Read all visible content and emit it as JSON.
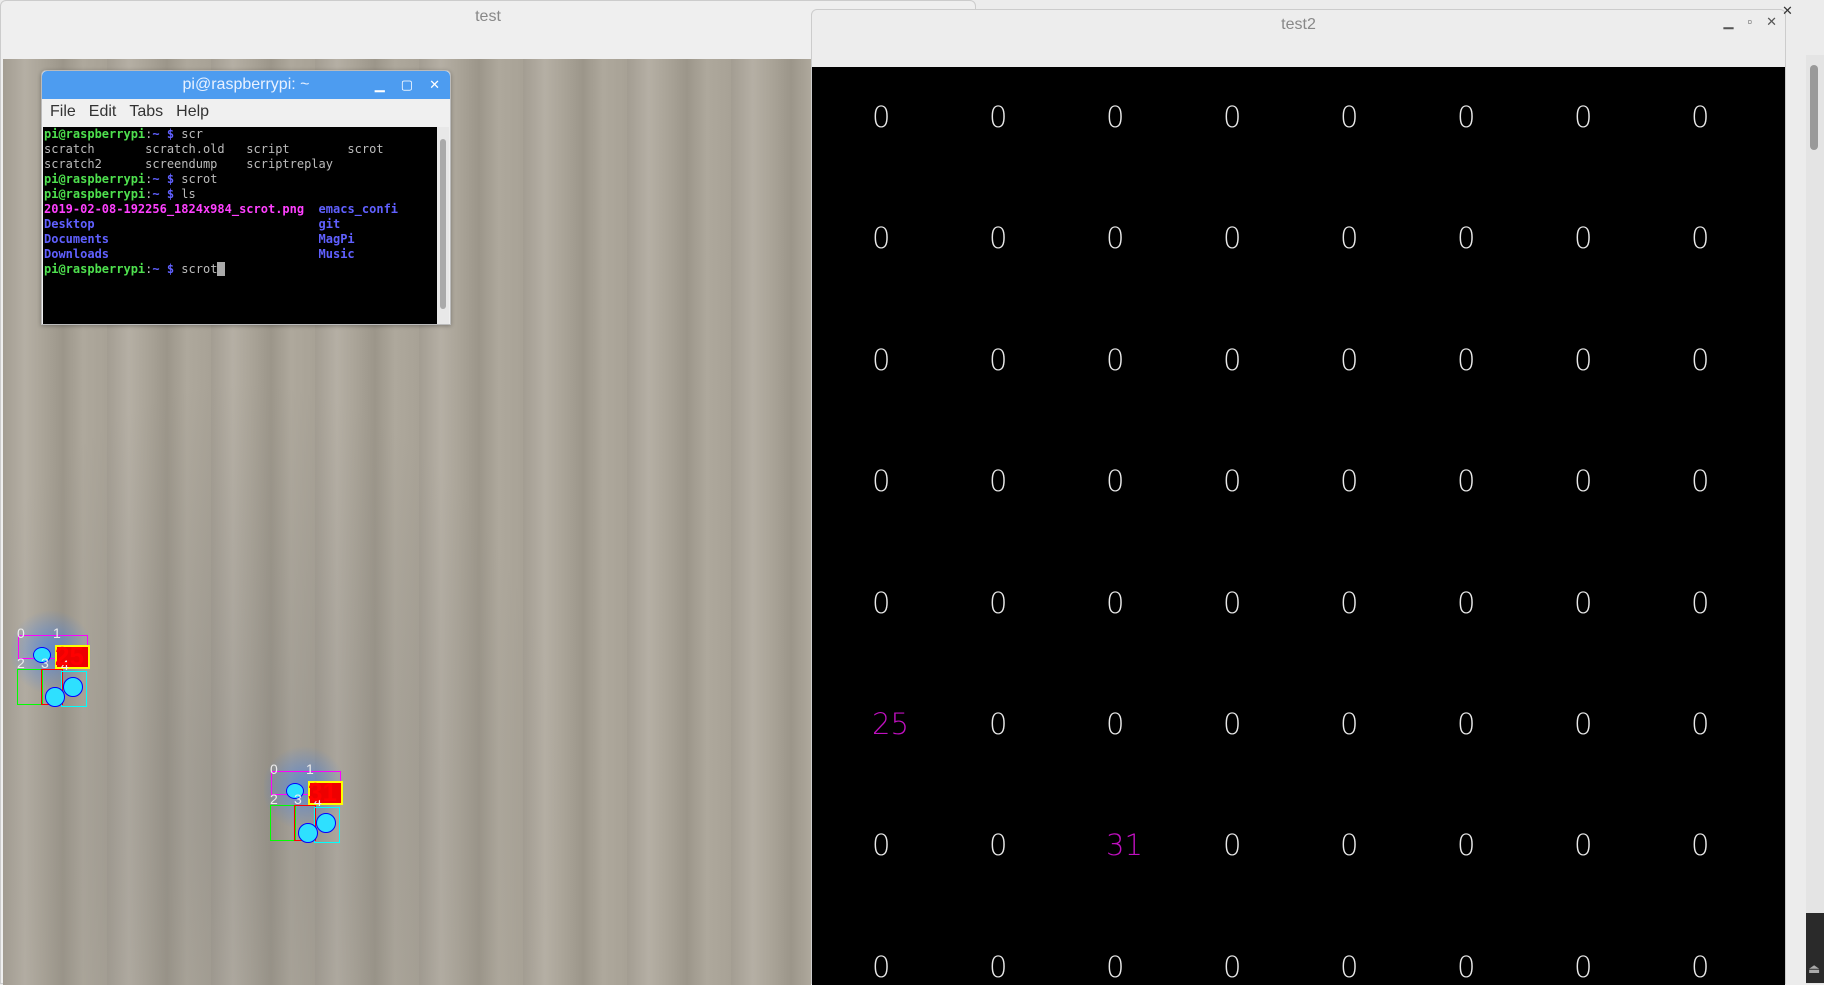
{
  "window1": {
    "title": "test"
  },
  "window2": {
    "title": "test2"
  },
  "terminal": {
    "title": "pi@raspberrypi: ~",
    "menu": [
      "File",
      "Edit",
      "Tabs",
      "Help"
    ],
    "lines": [
      [
        {
          "c": "g",
          "t": "pi@raspberrypi"
        },
        {
          "c": "w",
          "t": ":"
        },
        {
          "c": "b",
          "t": "~ $"
        },
        {
          "c": "w",
          "t": " scr"
        }
      ],
      [
        {
          "c": "w",
          "t": "scratch       scratch.old   script        scrot"
        }
      ],
      [
        {
          "c": "w",
          "t": "scratch2      screendump    scriptreplay"
        }
      ],
      [
        {
          "c": "g",
          "t": "pi@raspberrypi"
        },
        {
          "c": "w",
          "t": ":"
        },
        {
          "c": "b",
          "t": "~ $"
        },
        {
          "c": "w",
          "t": " scrot"
        }
      ],
      [
        {
          "c": "g",
          "t": "pi@raspberrypi"
        },
        {
          "c": "w",
          "t": ":"
        },
        {
          "c": "b",
          "t": "~ $"
        },
        {
          "c": "w",
          "t": " ls"
        }
      ],
      [
        {
          "c": "p",
          "t": "2019-02-08-192256_1824x984_scrot.png"
        },
        {
          "c": "w",
          "t": "  "
        },
        {
          "c": "b",
          "t": "emacs_confi"
        }
      ],
      [
        {
          "c": "b",
          "t": "Desktop                               git"
        }
      ],
      [
        {
          "c": "b",
          "t": "Documents                             MagPi"
        }
      ],
      [
        {
          "c": "b",
          "t": "Downloads                             Music"
        }
      ],
      [
        {
          "c": "g",
          "t": "pi@raspberrypi"
        },
        {
          "c": "w",
          "t": ":"
        },
        {
          "c": "b",
          "t": "~ $"
        },
        {
          "c": "w",
          "t": " scrot"
        }
      ]
    ]
  },
  "markers": [
    {
      "id": "25",
      "labels": [
        "0",
        "1",
        "2",
        "3",
        "4"
      ]
    },
    {
      "id": "31",
      "labels": [
        "0",
        "1",
        "2",
        "3",
        "4"
      ]
    }
  ],
  "grid": [
    [
      "0",
      "0",
      "0",
      "0",
      "0",
      "0",
      "0",
      "0"
    ],
    [
      "0",
      "0",
      "0",
      "0",
      "0",
      "0",
      "0",
      "0"
    ],
    [
      "0",
      "0",
      "0",
      "0",
      "0",
      "0",
      "0",
      "0"
    ],
    [
      "0",
      "0",
      "0",
      "0",
      "0",
      "0",
      "0",
      "0"
    ],
    [
      "0",
      "0",
      "0",
      "0",
      "0",
      "0",
      "0",
      "0"
    ],
    [
      "25",
      "0",
      "0",
      "0",
      "0",
      "0",
      "0",
      "0"
    ],
    [
      "0",
      "0",
      "31",
      "0",
      "0",
      "0",
      "0",
      "0"
    ],
    [
      "0",
      "0",
      "0",
      "0",
      "0",
      "0",
      "0",
      "0"
    ]
  ],
  "colors": {
    "zero": "#e8e8e8",
    "highlight": "#c010c0",
    "terminal_title": "#4d9cf0"
  }
}
